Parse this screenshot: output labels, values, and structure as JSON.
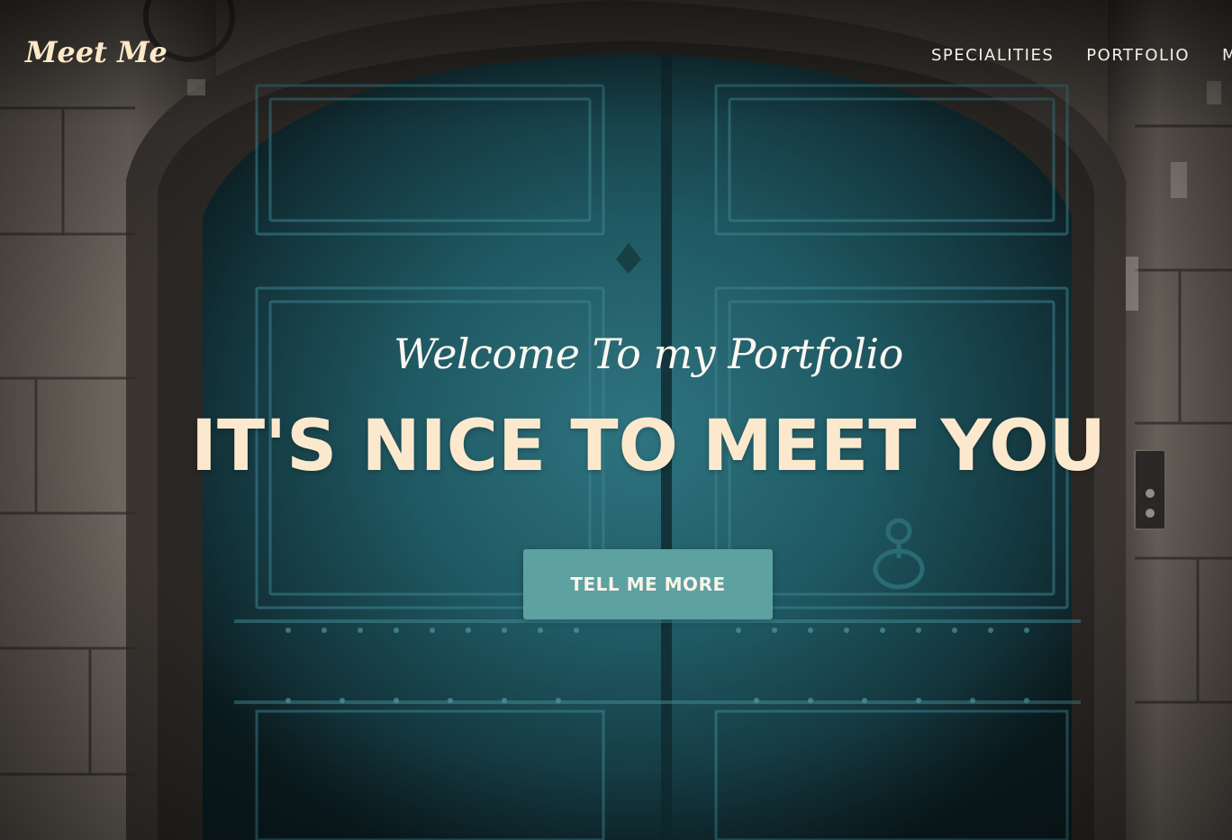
{
  "nav": {
    "brand": "Meet Me",
    "links": [
      {
        "label": "SPECIALITIES"
      },
      {
        "label": "PORTFOLIO"
      },
      {
        "label": "M"
      }
    ]
  },
  "hero": {
    "lead_in": "Welcome To my Portfolio",
    "heading": "IT'S NICE TO MEET YOU",
    "cta_label": "TELL ME MORE",
    "background_image": "stone-archway-teal-wooden-double-door"
  },
  "colors": {
    "brand": "#fde8c8",
    "nav_text": "#f4f0ea",
    "heading": "#fce9cd",
    "cta_background": "#5ea1a1",
    "cta_text": "#fbf4e8",
    "door_teal": "#1f5d66"
  }
}
